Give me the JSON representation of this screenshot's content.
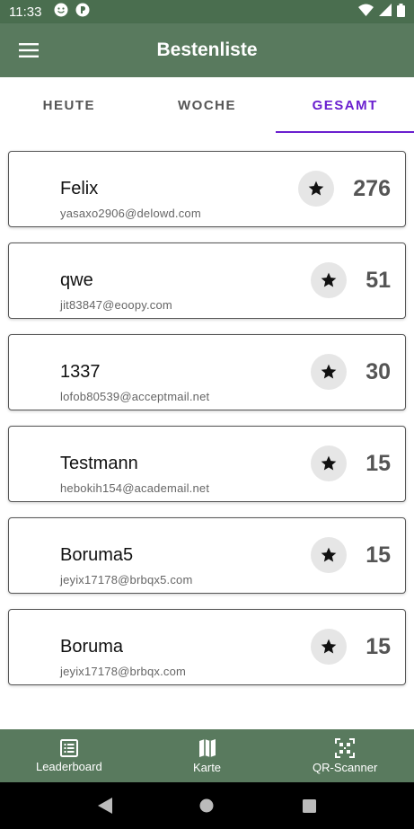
{
  "status_bar": {
    "time": "11:33"
  },
  "app_bar": {
    "title": "Bestenliste"
  },
  "tabs": [
    {
      "label": "HEUTE",
      "active": false
    },
    {
      "label": "WOCHE",
      "active": false
    },
    {
      "label": "GESAMT",
      "active": true
    }
  ],
  "leaderboard": [
    {
      "name": "Felix",
      "email": "yasaxo2906@delowd.com",
      "score": "276"
    },
    {
      "name": "qwe",
      "email": "jit83847@eoopy.com",
      "score": "51"
    },
    {
      "name": "1337",
      "email": "lofob80539@acceptmail.net",
      "score": "30"
    },
    {
      "name": "Testmann",
      "email": "hebokih154@academail.net",
      "score": "15"
    },
    {
      "name": "Boruma5",
      "email": "jeyix17178@brbqx5.com",
      "score": "15"
    },
    {
      "name": "Boruma",
      "email": "jeyix17178@brbqx.com",
      "score": "15"
    }
  ],
  "bottom_nav": [
    {
      "label": "Leaderboard",
      "icon": "list-icon"
    },
    {
      "label": "Karte",
      "icon": "map-icon"
    },
    {
      "label": "QR-Scanner",
      "icon": "qr-icon"
    }
  ],
  "colors": {
    "app_bar": "#597a5e",
    "status_bar": "#4a6e4f",
    "active_tab": "#6a1fcf"
  }
}
